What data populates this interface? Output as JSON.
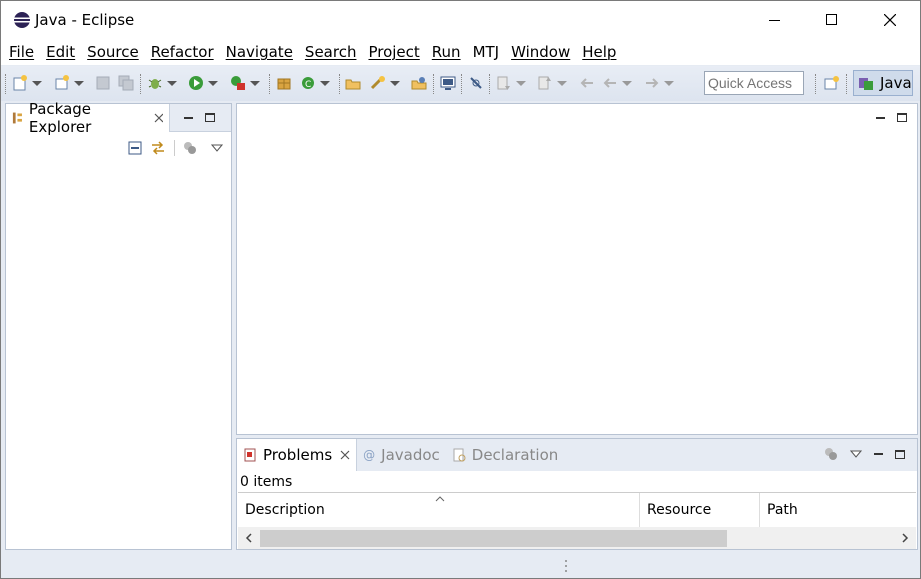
{
  "window": {
    "title": "Java - Eclipse",
    "minimize_icon": "minimize-icon",
    "maximize_icon": "maximize-icon",
    "close_icon": "close-icon"
  },
  "menu": [
    "File",
    "Edit",
    "Source",
    "Refactor",
    "Navigate",
    "Search",
    "Project",
    "Run",
    "MTJ",
    "Window",
    "Help"
  ],
  "toolbar": {
    "quick_access_placeholder": "Quick Access",
    "perspective_label": "Java"
  },
  "package_explorer": {
    "tab_label": "Package Explorer"
  },
  "bottom_panel": {
    "tabs": [
      "Problems",
      "Javadoc",
      "Declaration"
    ],
    "item_count": "0 items",
    "columns": [
      "Description",
      "Resource",
      "Path"
    ]
  },
  "colors": {
    "chrome_bg": "#e6ebf3",
    "accent": "#cfdbeb"
  }
}
